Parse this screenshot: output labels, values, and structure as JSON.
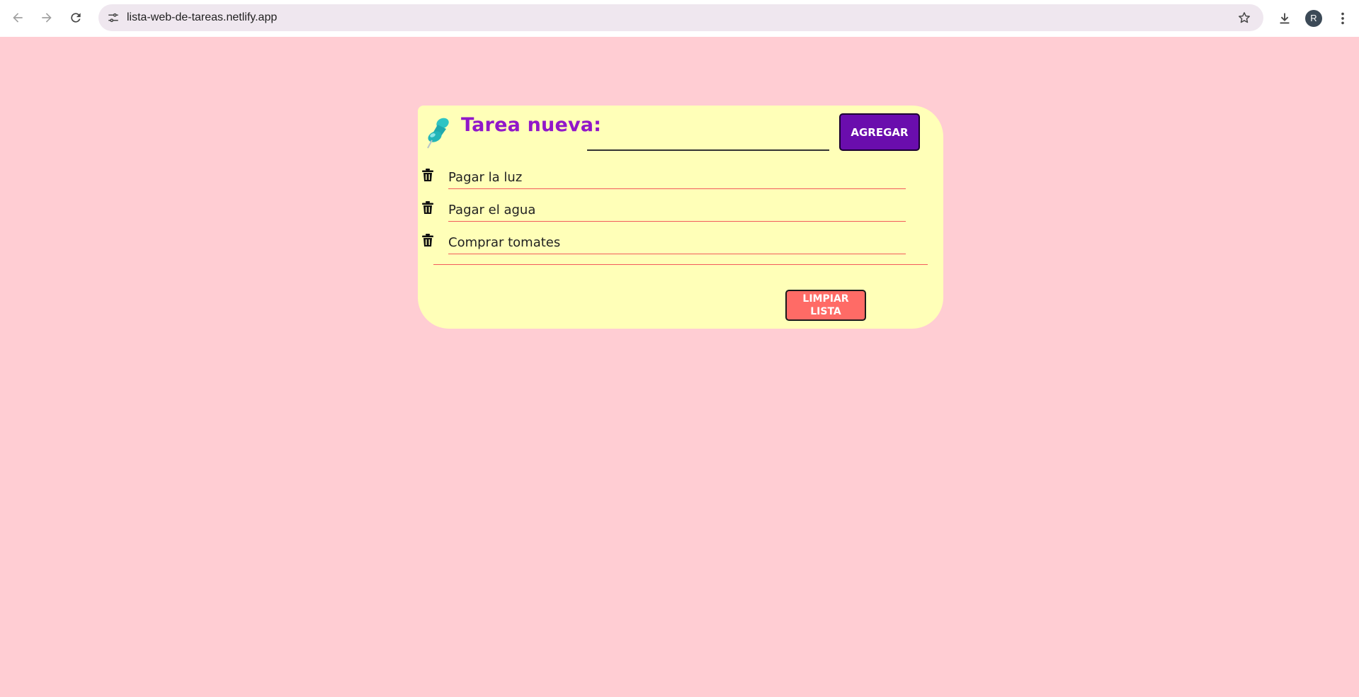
{
  "browser": {
    "url": "lista-web-de-tareas.netlify.app",
    "profile_initial": "R",
    "icons": {
      "back": "arrow-left-icon",
      "forward": "arrow-right-icon",
      "reload": "reload-icon",
      "site_info": "tune-icon",
      "bookmark": "star-icon",
      "download": "download-icon",
      "menu": "kebab-menu-icon"
    }
  },
  "app": {
    "heading": "Tarea nueva:",
    "input": {
      "value": "",
      "placeholder": ""
    },
    "add_label": "AGREGAR",
    "clear_label": "LIMPIAR LISTA",
    "tasks": [
      {
        "text": "Pagar la luz"
      },
      {
        "text": "Pagar el agua"
      },
      {
        "text": "Comprar tomates"
      }
    ]
  },
  "colors": {
    "page_background": "#ffcdd3",
    "card_background": "#ffffb8",
    "heading": "#9117c9",
    "add_button": "#6a0dad",
    "clear_button": "#ff6b66",
    "task_rule": "#f25b5b"
  }
}
